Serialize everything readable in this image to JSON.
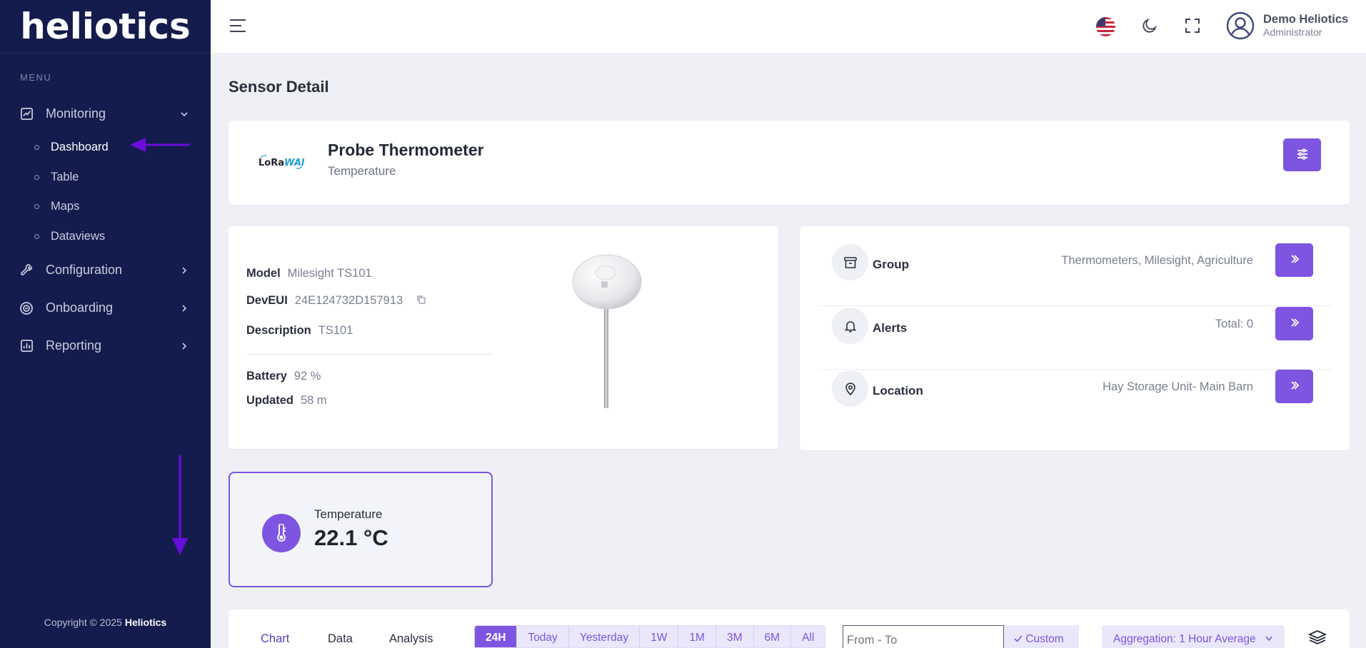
{
  "app": {
    "logo": "heliotics"
  },
  "sidebar": {
    "menu_title": "MENU",
    "items": [
      {
        "label": "Monitoring",
        "icon": "chart-line-icon",
        "expanded": true,
        "children": [
          {
            "label": "Dashboard"
          },
          {
            "label": "Table"
          },
          {
            "label": "Maps"
          },
          {
            "label": "Dataviews"
          }
        ]
      },
      {
        "label": "Configuration",
        "icon": "wrench-icon"
      },
      {
        "label": "Onboarding",
        "icon": "onboarding-icon"
      },
      {
        "label": "Reporting",
        "icon": "report-icon"
      }
    ],
    "copyright_prefix": "Copyright © 2025 ",
    "copyright_brand": "Heliotics"
  },
  "topbar": {
    "user_name": "Demo Heliotics",
    "user_role": "Administrator"
  },
  "page": {
    "title": "Sensor Detail"
  },
  "sensor": {
    "network_logo": "LoRaWAN",
    "name": "Probe Thermometer",
    "type": "Temperature",
    "model_label": "Model",
    "model": "Milesight TS101",
    "deveui_label": "DevEUI",
    "deveui": "24E124732D157913",
    "description_label": "Description",
    "description": "TS101",
    "battery_label": "Battery",
    "battery": "92 %",
    "updated_label": "Updated",
    "updated": "58 m"
  },
  "meta": [
    {
      "name": "Group",
      "value": "Thermometers, Milesight, Agriculture",
      "icon": "archive-icon"
    },
    {
      "name": "Alerts",
      "value": "Total: 0",
      "icon": "bell-icon"
    },
    {
      "name": "Location",
      "value": "Hay Storage Unit- Main Barn",
      "icon": "map-pin-icon"
    }
  ],
  "reading": {
    "label": "Temperature",
    "value": "22.1 °C"
  },
  "chart_toolbar": {
    "tabs": [
      "Chart",
      "Data",
      "Analysis"
    ],
    "active_tab": "Chart",
    "ranges": [
      "24H",
      "Today",
      "Yesterday",
      "1W",
      "1M",
      "3M",
      "6M",
      "All"
    ],
    "active_range": "24H",
    "date_placeholder": "From - To",
    "custom_label": "Custom",
    "aggregation_label": "Aggregation: 1 Hour Average"
  },
  "colors": {
    "accent": "#7d55e0",
    "sidebar": "#141c4d",
    "annotation": "#6a0dd8"
  }
}
